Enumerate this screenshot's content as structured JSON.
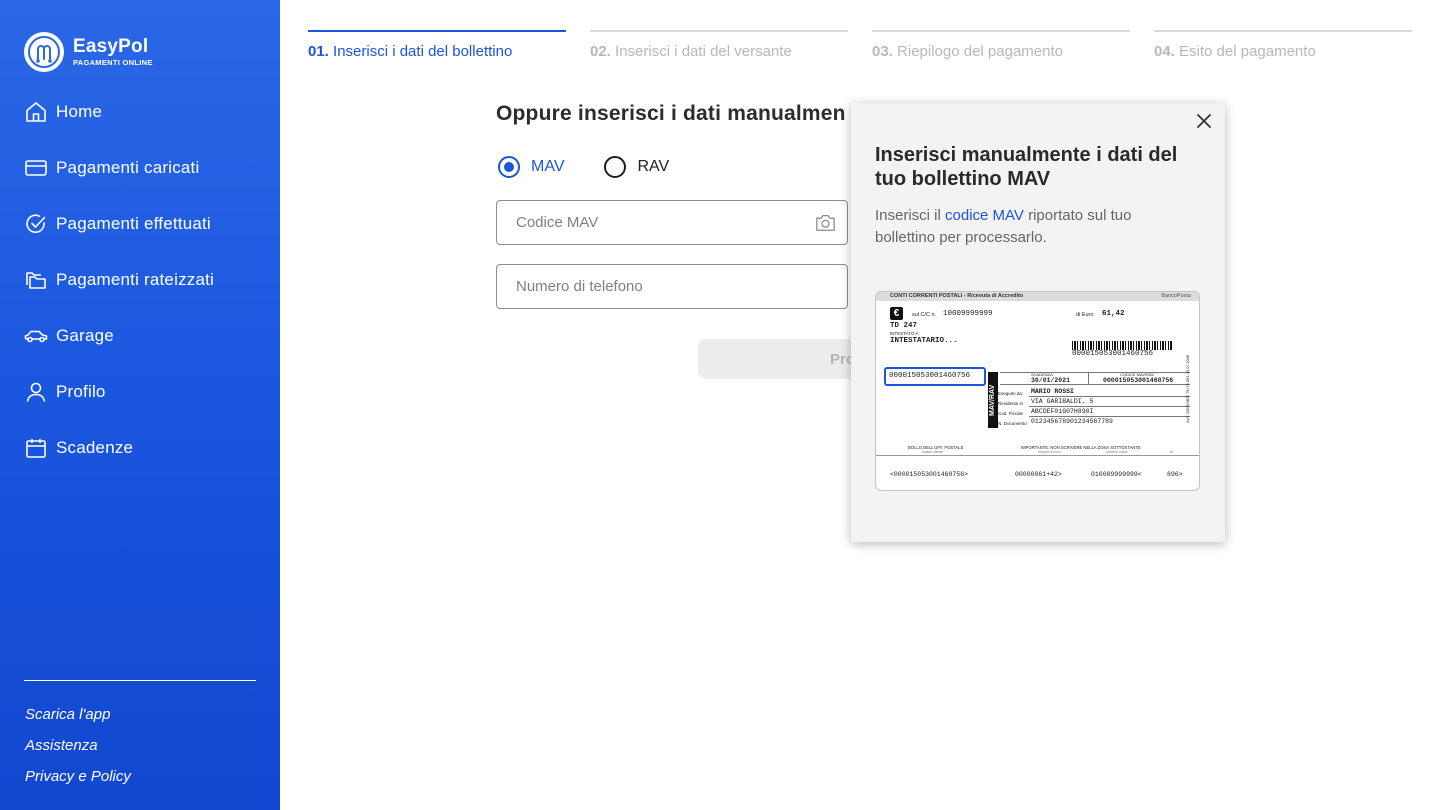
{
  "brand": {
    "title": "EasyPol",
    "subtitle": "PAGAMENTI ONLINE"
  },
  "nav": [
    {
      "label": "Home",
      "icon": "home-icon"
    },
    {
      "label": "Pagamenti caricati",
      "icon": "card-icon"
    },
    {
      "label": "Pagamenti effettuati",
      "icon": "check-circle-icon"
    },
    {
      "label": "Pagamenti rateizzati",
      "icon": "folders-icon"
    },
    {
      "label": "Garage",
      "icon": "car-icon"
    },
    {
      "label": "Profilo",
      "icon": "user-icon"
    },
    {
      "label": "Scadenze",
      "icon": "calendar-icon"
    }
  ],
  "side_links": [
    "Scarica l'app",
    "Assistenza",
    "Privacy e Policy"
  ],
  "steps": [
    {
      "num": "01.",
      "label": "Inserisci i dati del bollettino",
      "active": true
    },
    {
      "num": "02.",
      "label": "Inserisci i dati del versante",
      "active": false
    },
    {
      "num": "03.",
      "label": "Riepilogo del pagamento",
      "active": false
    },
    {
      "num": "04.",
      "label": "Esito del pagamento",
      "active": false
    }
  ],
  "form": {
    "title": "Oppure inserisci i dati manualmen",
    "radio_options": [
      "MAV",
      "RAV"
    ],
    "selected": "MAV",
    "code_placeholder": "Codice MAV",
    "phone_placeholder": "Numero di telefono",
    "proceed_label": "Pro"
  },
  "popover": {
    "title": "Inserisci manualmente i dati del tuo bollettino MAV",
    "text_before": "Inserisci il ",
    "text_highlight": "codice MAV",
    "text_after": " riportato sul tuo bollettino per processarlo."
  },
  "slip": {
    "header": "CONTI CORRENTI POSTALI - Ricevuta di Accredito",
    "header_brand": "BancoPosta",
    "account_label": "sul C/C n.",
    "account": "10009999999",
    "amount_label": "di Euro",
    "amount": "61,42",
    "td": "TD 247",
    "intestato_label": "INTESTATO A",
    "intestatario": "INTESTATARIO...",
    "barcode_number": "000015053001460756",
    "highlighted_code": "000015053001460756",
    "scadenza_label": "SCADENZA",
    "codice_label": "CODICE MAV/RAV",
    "scadenza": "30/01/2021",
    "codice": "000015053001460756",
    "mav_rav": "MAV/RAV",
    "eseguito_label": "Eseguito da:",
    "eseguito": "MARIO ROSSI",
    "residente_label": "Residente in",
    "residente": "VIA GARIBALDI, 5",
    "cod_fiscale_label": "Cod. Fiscale",
    "cod_fiscale": "ABCDEF01G07H890I",
    "documento_label": "N. Documento",
    "documento": "012345678901234567789",
    "bollo_label": "BOLLO DELL'UFF. POSTALE",
    "bollo_sub": "codice cliente",
    "importante": "IMPORTANTE: NON SCRIVERE NELLA ZONA SOTTOSTANTE",
    "importante_sub": "importo in euro",
    "numero_conto_sub": "numero conto",
    "td_sub": "td",
    "side_text": "AUT. DB/SISB/E 79176 DEL 25.07.2008",
    "code_line": [
      "<000015053001460756>",
      "00000061+42>",
      "010009999999<",
      "896>"
    ]
  }
}
